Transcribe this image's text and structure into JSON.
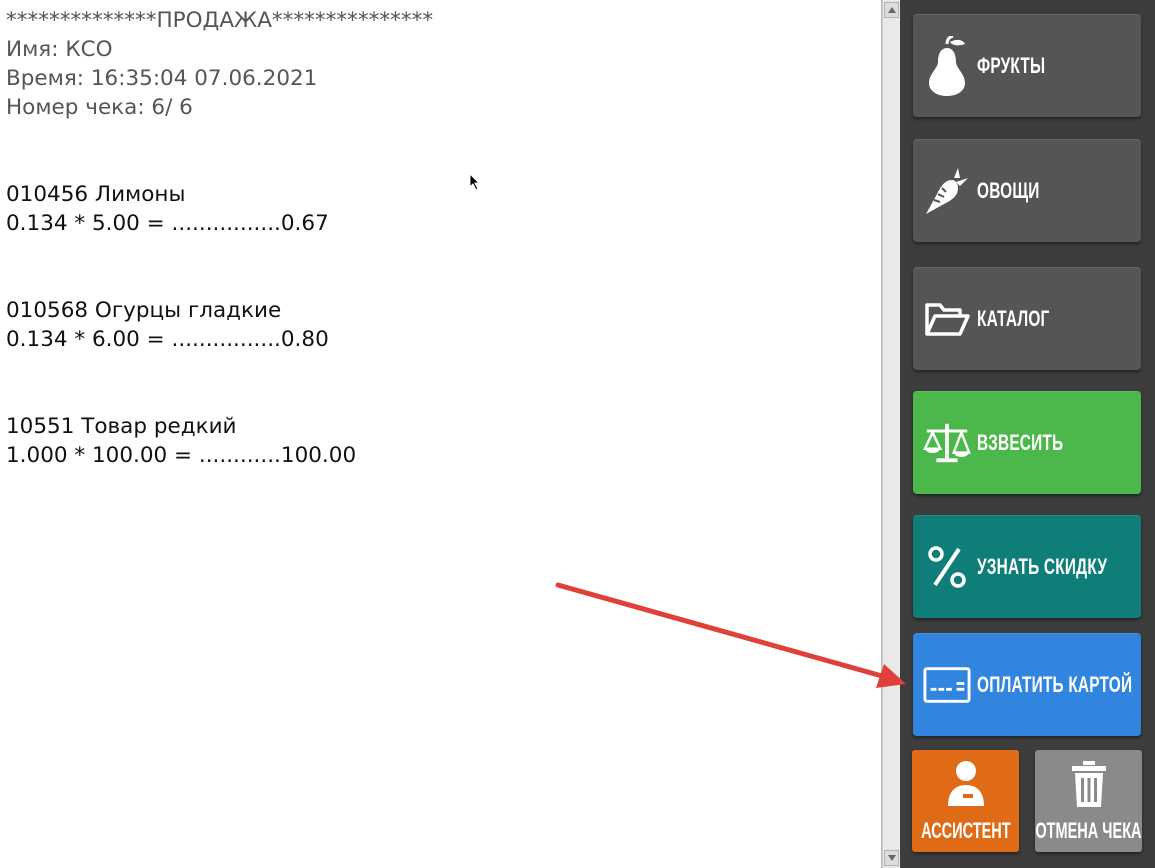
{
  "receipt": {
    "header": "**************ПРОДАЖА***************",
    "name_line": "Имя: КСО",
    "time_line": "Время: 16:35:04 07.06.2021",
    "check_line": "Номер чека: 6/ 6",
    "items": [
      {
        "title": "010456 Лимоны",
        "calc": "0.134 * 5.00 = ................0.67"
      },
      {
        "title": "010568 Огурцы гладкие",
        "calc": "0.134 * 6.00 = ................0.80"
      },
      {
        "title": "10551 Товар редкий",
        "calc": "1.000 * 100.00 = ............100.00"
      }
    ]
  },
  "side_panel": {
    "fruits": {
      "label": "ФРУКТЫ",
      "icon": "pear-icon",
      "color": "#555555"
    },
    "vegetables": {
      "label": "ОВОЩИ",
      "icon": "carrot-icon",
      "color": "#555555"
    },
    "catalog": {
      "label": "КАТАЛОГ",
      "icon": "folder-icon",
      "color": "#555555"
    },
    "weigh": {
      "label": "ВЗВЕСИТЬ",
      "icon": "scales-icon",
      "color": "#4cb84c"
    },
    "discount": {
      "label": "УЗНАТЬ СКИДКУ",
      "icon": "percent-icon",
      "color": "#0f7d78"
    },
    "pay_card": {
      "label": "ОПЛАТИТЬ КАРТОЙ",
      "icon": "credit-card-icon",
      "color": "#3185de"
    },
    "assistant": {
      "label": "АССИСТЕНТ",
      "icon": "user-icon",
      "color": "#df6b16"
    },
    "cancel_check": {
      "label": "ОТМЕНА ЧЕКА",
      "icon": "trash-icon",
      "color": "#8a8a8a"
    }
  },
  "annotation": {
    "color": "#e0403a"
  }
}
